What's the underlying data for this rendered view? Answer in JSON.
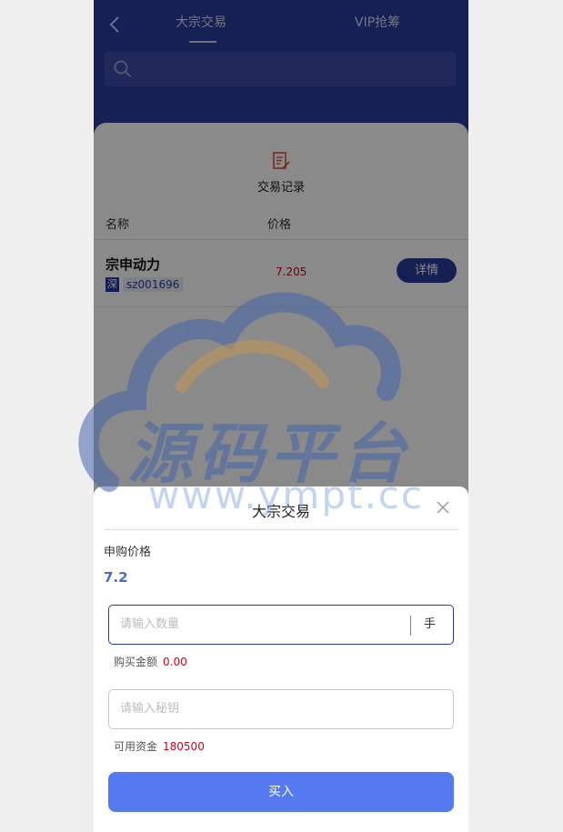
{
  "header": {
    "tabs": [
      {
        "label": "大宗交易",
        "active": true
      },
      {
        "label": "VIP抢筹",
        "active": false
      }
    ],
    "back_icon": "chevron-left-icon",
    "search_icon": "search-icon"
  },
  "records": {
    "label": "交易记录",
    "icon": "document-edit-icon"
  },
  "table": {
    "headers": [
      "名称",
      "价格"
    ],
    "rows": [
      {
        "name": "宗申动力",
        "market": "深",
        "code": "sz001696",
        "price": "7.205",
        "action": "详情"
      }
    ]
  },
  "modal": {
    "title": "大宗交易",
    "close_icon": "close-icon",
    "price_label": "申购价格",
    "price_value": "7.2",
    "quantity_placeholder": "请输入数量",
    "quantity_unit": "手",
    "amount_label": "购买金额",
    "amount_value": "0.00",
    "key_placeholder": "请输入秘钥",
    "funds_label": "可用资金",
    "funds_value": "180500",
    "buy_label": "买入"
  },
  "watermark": {
    "text": "源码平台",
    "url": "www.ympt.cc"
  },
  "colors": {
    "header": "#2a3b9a",
    "accent": "#5579f0",
    "price_red": "#d0021b",
    "price_blue": "#4a6ad0"
  }
}
